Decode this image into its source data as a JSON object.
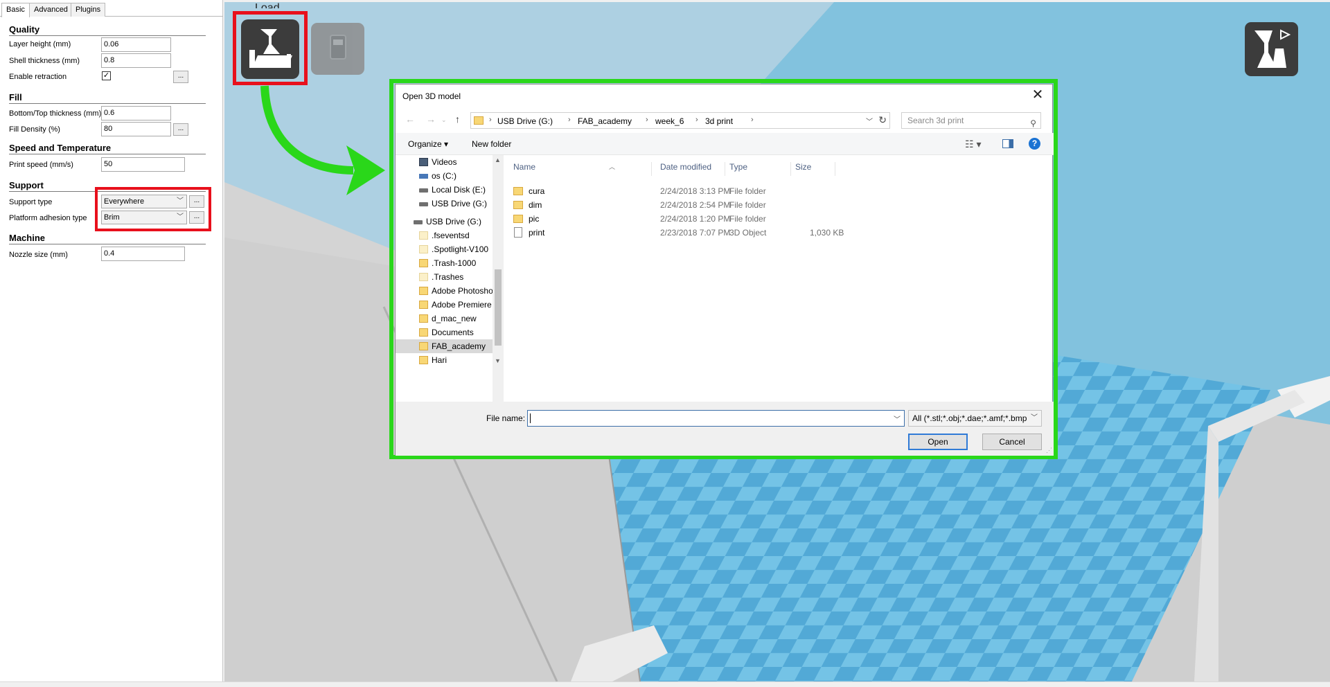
{
  "settings": {
    "tabs": [
      "Basic",
      "Advanced",
      "Plugins"
    ],
    "sections": {
      "quality": "Quality",
      "fill": "Fill",
      "speed": "Speed and Temperature",
      "support": "Support",
      "machine": "Machine"
    },
    "layer_height": {
      "label": "Layer height (mm)",
      "value": "0.06"
    },
    "shell_thickness": {
      "label": "Shell thickness (mm)",
      "value": "0.8"
    },
    "enable_retraction": {
      "label": "Enable retraction",
      "checked_glyph": "✓"
    },
    "bottom_top_thickness": {
      "label": "Bottom/Top thickness (mm)",
      "value": "0.6"
    },
    "fill_density": {
      "label": "Fill Density (%)",
      "value": "80"
    },
    "print_speed": {
      "label": "Print speed (mm/s)",
      "value": "50"
    },
    "support_type": {
      "label": "Support type",
      "value": "Everywhere"
    },
    "platform_adhesion": {
      "label": "Platform adhesion type",
      "value": "Brim"
    },
    "nozzle_size": {
      "label": "Nozzle size (mm)",
      "value": "0.4"
    },
    "dots_label": "..."
  },
  "viewport": {
    "load_label": "Load",
    "highlight_color": "#e8101c",
    "arrow_color": "#2ad71a",
    "bed_color": "#5fb4dc"
  },
  "dialog": {
    "title": "Open 3D model",
    "close_glyph": "✕",
    "breadcrumbs": [
      "USB Drive (G:)",
      "FAB_academy",
      "week_6",
      "3d print"
    ],
    "search_placeholder": "Search 3d print",
    "toolbar": {
      "organize": "Organize ▾",
      "new_folder": "New folder"
    },
    "nav_items": [
      {
        "label": "Videos",
        "icon": "videos-icon"
      },
      {
        "label": "os (C:)",
        "icon": "os-drive-icon"
      },
      {
        "label": "Local Disk (E:)",
        "icon": "drive-icon"
      },
      {
        "label": "USB Drive (G:)",
        "icon": "drive-icon"
      },
      {
        "label": "USB Drive (G:)",
        "icon": "drive-icon"
      },
      {
        "label": ".fseventsd",
        "icon": "folder-icon"
      },
      {
        "label": ".Spotlight-V100",
        "icon": "folder-icon"
      },
      {
        "label": ".Trash-1000",
        "icon": "folder-icon"
      },
      {
        "label": ".Trashes",
        "icon": "folder-icon"
      },
      {
        "label": "Adobe Photoshop",
        "icon": "folder-icon"
      },
      {
        "label": "Adobe Premiere",
        "icon": "folder-icon"
      },
      {
        "label": "d_mac_new",
        "icon": "folder-icon"
      },
      {
        "label": "Documents",
        "icon": "folder-icon"
      },
      {
        "label": "FAB_academy",
        "icon": "folder-icon"
      },
      {
        "label": "Hari",
        "icon": "folder-icon"
      }
    ],
    "columns": [
      "Name",
      "Date modified",
      "Type",
      "Size"
    ],
    "files": [
      {
        "name": "cura",
        "date": "2/24/2018 3:13 PM",
        "type": "File folder",
        "size": ""
      },
      {
        "name": "dim",
        "date": "2/24/2018 2:54 PM",
        "type": "File folder",
        "size": ""
      },
      {
        "name": "pic",
        "date": "2/24/2018 1:20 PM",
        "type": "File folder",
        "size": ""
      },
      {
        "name": "print",
        "date": "2/23/2018 7:07 PM",
        "type": "3D Object",
        "size": "1,030 KB"
      }
    ],
    "file_name_label": "File name:",
    "file_name_value": "",
    "file_type": "All (*.stl;*.obj;*.dae;*.amf;*.bmp",
    "open_label": "Open",
    "cancel_label": "Cancel"
  }
}
